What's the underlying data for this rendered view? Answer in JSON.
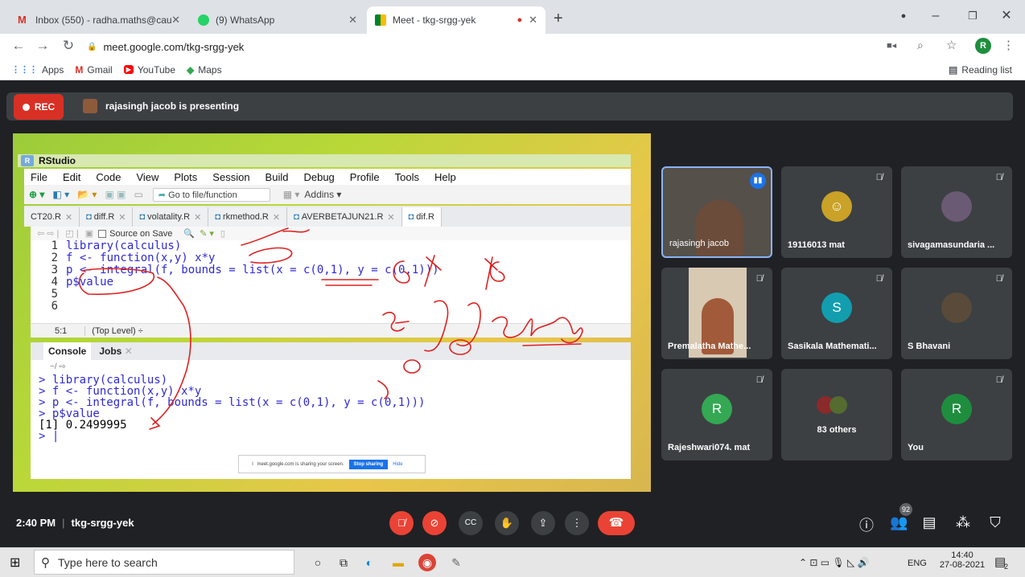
{
  "browser": {
    "tabs": [
      {
        "label": "Inbox (550) - radha.maths@cauve",
        "icon": "gmail-icon"
      },
      {
        "label": "(9) WhatsApp",
        "icon": "whatsapp-icon"
      },
      {
        "label": "Meet - tkg-srgg-yek",
        "icon": "meet-icon"
      }
    ],
    "new_tab": "+",
    "url": "meet.google.com/tkg-srgg-yek",
    "profile_initial": "R",
    "bookmarks": [
      "Apps",
      "Gmail",
      "YouTube",
      "Maps"
    ],
    "reading_list": "Reading list"
  },
  "meet": {
    "rec_label": "REC",
    "presenting_text": "rajasingh jacob is presenting",
    "time": "2:40 PM",
    "meeting_code": "tkg-srgg-yek",
    "participant_badge": "92",
    "tiles": [
      {
        "name": "rajasingh jacob",
        "type": "video"
      },
      {
        "name": "19116013 mat",
        "type": "avatar",
        "color": "#c9a227"
      },
      {
        "name": "sivagamasundaria ...",
        "type": "avatar",
        "color": "#6b5a73"
      },
      {
        "name": "Premalatha Mathe...",
        "type": "video"
      },
      {
        "name": "Sasikala Mathemati...",
        "type": "initial",
        "initial": "S",
        "color": "#129eaf"
      },
      {
        "name": "S Bhavani",
        "type": "avatar",
        "color": "#5a4a3a"
      },
      {
        "name": "Rajeshwari074. mat",
        "type": "initial",
        "initial": "R",
        "color": "#34a853"
      },
      {
        "name": "83 others",
        "type": "others"
      },
      {
        "name": "You",
        "type": "initial",
        "initial": "R",
        "color": "#1e8e3e"
      }
    ]
  },
  "rstudio": {
    "title": "RStudio",
    "menu": [
      "File",
      "Edit",
      "Code",
      "View",
      "Plots",
      "Session",
      "Build",
      "Debug",
      "Profile",
      "Tools",
      "Help"
    ],
    "goto": "Go to file/function",
    "addins": "Addins",
    "file_tabs": [
      "CT20.R",
      "diff.R",
      "volatality.R",
      "rkmethod.R",
      "AVERBETAJUN21.R",
      "dif.R"
    ],
    "source_on_save": "Source on Save",
    "code_lines": [
      {
        "n": "1",
        "code": "library(calculus)"
      },
      {
        "n": "2",
        "code": "f <- function(x,y) x*y"
      },
      {
        "n": "3",
        "code": "p <- integral(f, bounds = list(x = c(0,1), y = c(0,1)))"
      },
      {
        "n": "4",
        "code": "p$value"
      },
      {
        "n": "5",
        "code": ""
      },
      {
        "n": "6",
        "code": ""
      }
    ],
    "cursor_pos": "5:1",
    "scope": "(Top Level) ÷",
    "console_tab": "Console",
    "jobs_tab": "Jobs",
    "console_path": "~/",
    "console_lines": [
      "> library(calculus)",
      "> f <- function(x,y) x*y",
      "> p <- integral(f, bounds = list(x = c(0,1), y = c(0,1)))",
      "> p$value",
      "[1] 0.2499995",
      "> |"
    ],
    "sharing_text": "meet.google.com is sharing your screen.",
    "stop_sharing": "Stop sharing",
    "hide": "Hide"
  },
  "taskbar": {
    "search_placeholder": "Type here to search",
    "lang": "ENG",
    "time": "14:40",
    "date": "27-08-2021",
    "notif_count": "2"
  }
}
